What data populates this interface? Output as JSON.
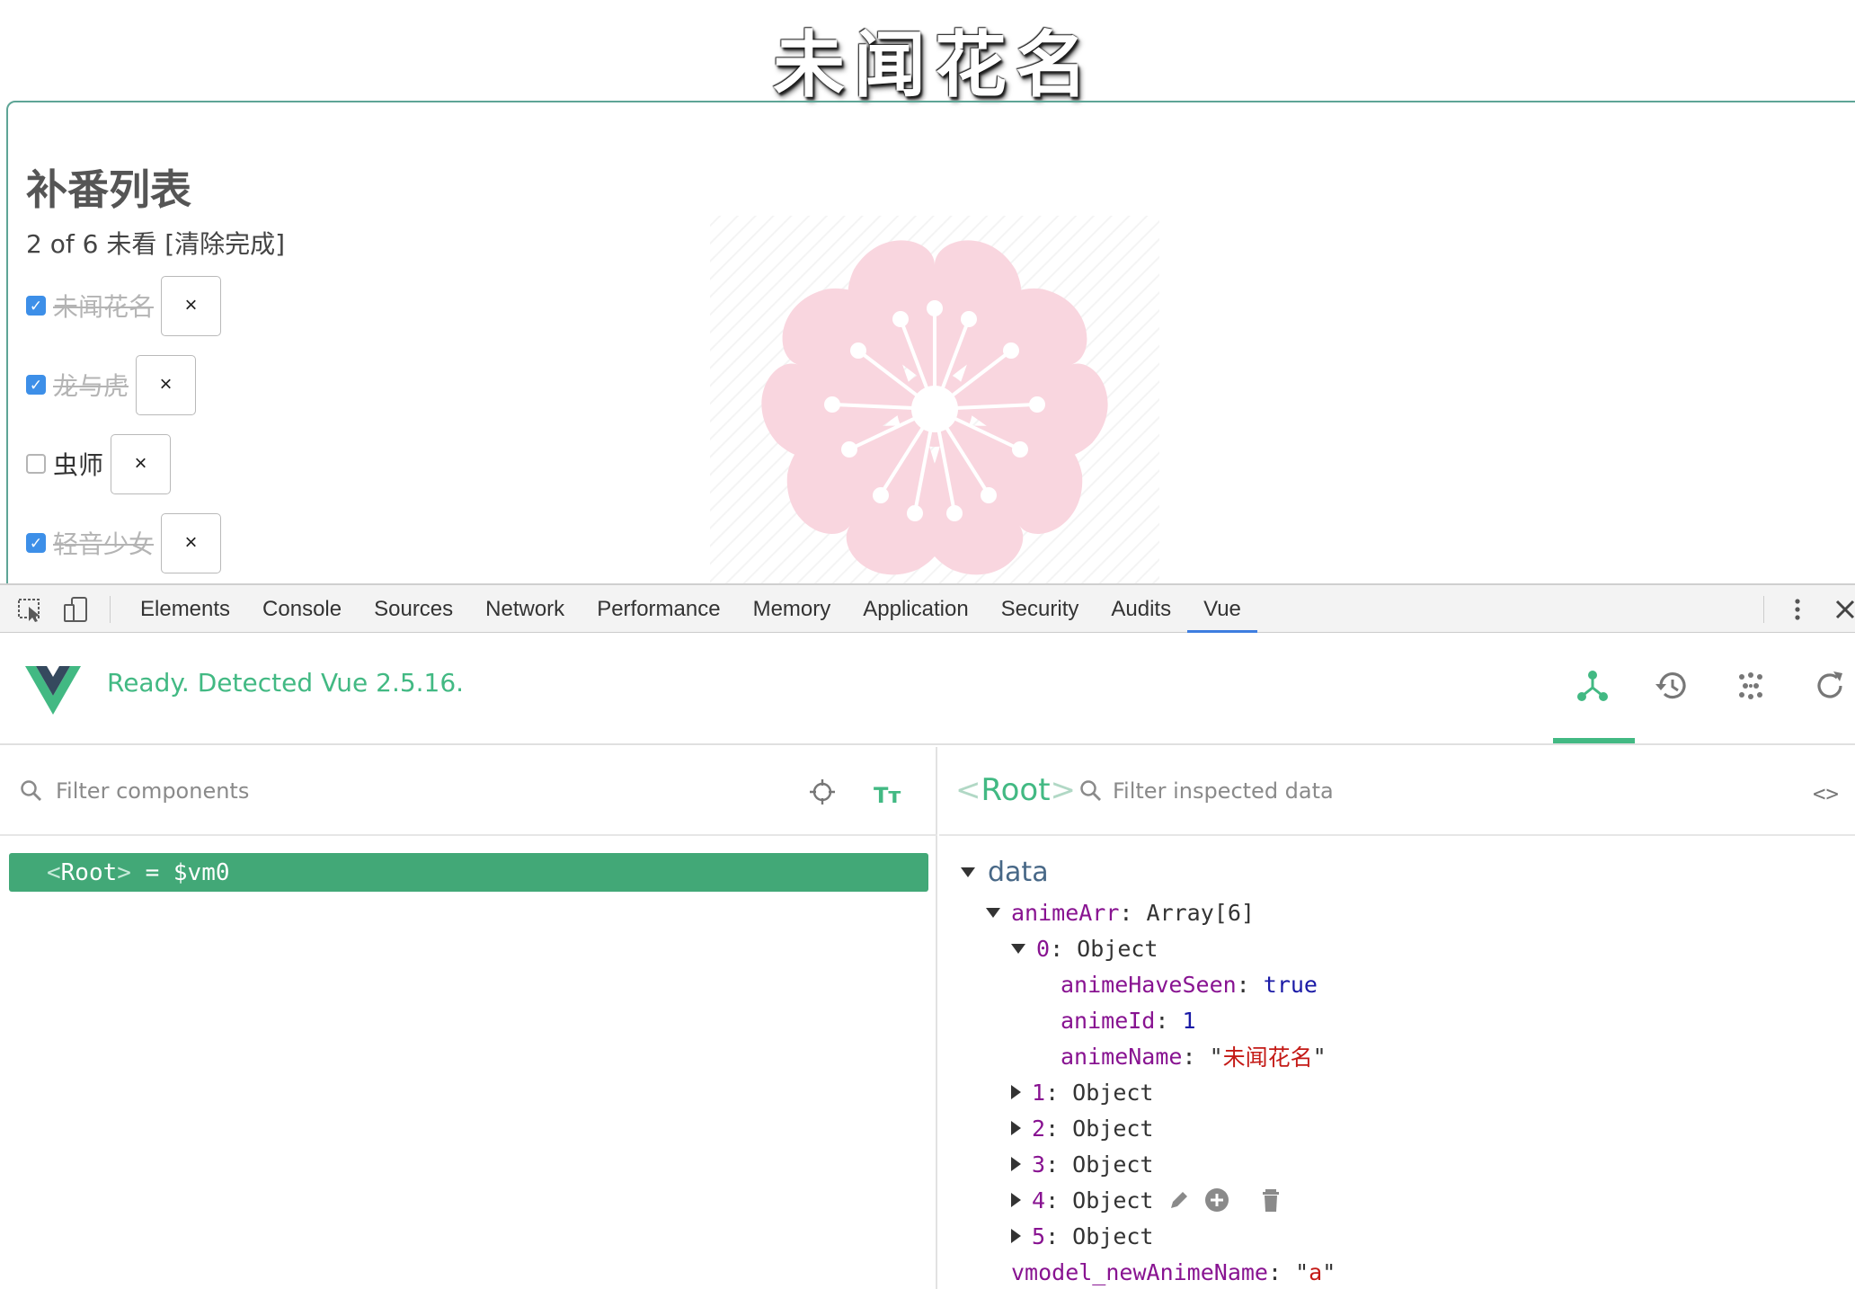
{
  "page": {
    "site_title": "未闻花名",
    "list_title": "补番列表",
    "stats": "2 of 6 未看 [清除完成]",
    "todos": [
      {
        "name": "未闻花名",
        "done": true
      },
      {
        "name": "龙与虎",
        "done": true
      },
      {
        "name": "虫师",
        "done": false
      },
      {
        "name": "轻音少女",
        "done": true
      }
    ],
    "delete_label": "×"
  },
  "devtools": {
    "tabs": [
      "Elements",
      "Console",
      "Sources",
      "Network",
      "Performance",
      "Memory",
      "Application",
      "Security",
      "Audits",
      "Vue"
    ],
    "active_tab": "Vue"
  },
  "vue": {
    "status": "Ready. Detected Vue 2.5.16.",
    "accent_color": "#42b983",
    "toolbar_icons": [
      "components-icon",
      "vuex-history-icon",
      "events-icon",
      "refresh-icon"
    ],
    "components": {
      "filter_placeholder": "Filter components",
      "root_tag": "Root",
      "root_ref": "= $vm0"
    },
    "inspector": {
      "selected": "Root",
      "filter_placeholder": "Filter inspected data",
      "section": "data",
      "anime_arr_key": "animeArr",
      "anime_arr_type": "Array[6]",
      "item_type": "Object",
      "item0": {
        "index": "0",
        "fields": [
          {
            "key": "animeHaveSeen",
            "value": "true",
            "kind": "bool"
          },
          {
            "key": "animeId",
            "value": "1",
            "kind": "num"
          },
          {
            "key": "animeName",
            "value": "未闻花名",
            "kind": "str"
          }
        ]
      },
      "collapsed_items": [
        "1",
        "2",
        "3",
        "4",
        "5"
      ],
      "vmodel_key": "vmodel_newAnimeName",
      "vmodel_value": "a"
    }
  }
}
